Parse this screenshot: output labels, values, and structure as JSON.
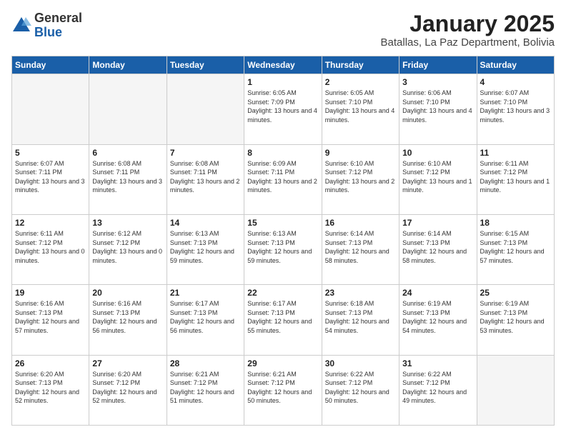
{
  "logo": {
    "general": "General",
    "blue": "Blue"
  },
  "header": {
    "title": "January 2025",
    "subtitle": "Batallas, La Paz Department, Bolivia"
  },
  "weekdays": [
    "Sunday",
    "Monday",
    "Tuesday",
    "Wednesday",
    "Thursday",
    "Friday",
    "Saturday"
  ],
  "weeks": [
    [
      {
        "day": "",
        "sunrise": "",
        "sunset": "",
        "daylight": "",
        "empty": true
      },
      {
        "day": "",
        "sunrise": "",
        "sunset": "",
        "daylight": "",
        "empty": true
      },
      {
        "day": "",
        "sunrise": "",
        "sunset": "",
        "daylight": "",
        "empty": true
      },
      {
        "day": "1",
        "sunrise": "Sunrise: 6:05 AM",
        "sunset": "Sunset: 7:09 PM",
        "daylight": "Daylight: 13 hours and 4 minutes."
      },
      {
        "day": "2",
        "sunrise": "Sunrise: 6:05 AM",
        "sunset": "Sunset: 7:10 PM",
        "daylight": "Daylight: 13 hours and 4 minutes."
      },
      {
        "day": "3",
        "sunrise": "Sunrise: 6:06 AM",
        "sunset": "Sunset: 7:10 PM",
        "daylight": "Daylight: 13 hours and 4 minutes."
      },
      {
        "day": "4",
        "sunrise": "Sunrise: 6:07 AM",
        "sunset": "Sunset: 7:10 PM",
        "daylight": "Daylight: 13 hours and 3 minutes."
      }
    ],
    [
      {
        "day": "5",
        "sunrise": "Sunrise: 6:07 AM",
        "sunset": "Sunset: 7:11 PM",
        "daylight": "Daylight: 13 hours and 3 minutes."
      },
      {
        "day": "6",
        "sunrise": "Sunrise: 6:08 AM",
        "sunset": "Sunset: 7:11 PM",
        "daylight": "Daylight: 13 hours and 3 minutes."
      },
      {
        "day": "7",
        "sunrise": "Sunrise: 6:08 AM",
        "sunset": "Sunset: 7:11 PM",
        "daylight": "Daylight: 13 hours and 2 minutes."
      },
      {
        "day": "8",
        "sunrise": "Sunrise: 6:09 AM",
        "sunset": "Sunset: 7:11 PM",
        "daylight": "Daylight: 13 hours and 2 minutes."
      },
      {
        "day": "9",
        "sunrise": "Sunrise: 6:10 AM",
        "sunset": "Sunset: 7:12 PM",
        "daylight": "Daylight: 13 hours and 2 minutes."
      },
      {
        "day": "10",
        "sunrise": "Sunrise: 6:10 AM",
        "sunset": "Sunset: 7:12 PM",
        "daylight": "Daylight: 13 hours and 1 minute."
      },
      {
        "day": "11",
        "sunrise": "Sunrise: 6:11 AM",
        "sunset": "Sunset: 7:12 PM",
        "daylight": "Daylight: 13 hours and 1 minute."
      }
    ],
    [
      {
        "day": "12",
        "sunrise": "Sunrise: 6:11 AM",
        "sunset": "Sunset: 7:12 PM",
        "daylight": "Daylight: 13 hours and 0 minutes."
      },
      {
        "day": "13",
        "sunrise": "Sunrise: 6:12 AM",
        "sunset": "Sunset: 7:12 PM",
        "daylight": "Daylight: 13 hours and 0 minutes."
      },
      {
        "day": "14",
        "sunrise": "Sunrise: 6:13 AM",
        "sunset": "Sunset: 7:13 PM",
        "daylight": "Daylight: 12 hours and 59 minutes."
      },
      {
        "day": "15",
        "sunrise": "Sunrise: 6:13 AM",
        "sunset": "Sunset: 7:13 PM",
        "daylight": "Daylight: 12 hours and 59 minutes."
      },
      {
        "day": "16",
        "sunrise": "Sunrise: 6:14 AM",
        "sunset": "Sunset: 7:13 PM",
        "daylight": "Daylight: 12 hours and 58 minutes."
      },
      {
        "day": "17",
        "sunrise": "Sunrise: 6:14 AM",
        "sunset": "Sunset: 7:13 PM",
        "daylight": "Daylight: 12 hours and 58 minutes."
      },
      {
        "day": "18",
        "sunrise": "Sunrise: 6:15 AM",
        "sunset": "Sunset: 7:13 PM",
        "daylight": "Daylight: 12 hours and 57 minutes."
      }
    ],
    [
      {
        "day": "19",
        "sunrise": "Sunrise: 6:16 AM",
        "sunset": "Sunset: 7:13 PM",
        "daylight": "Daylight: 12 hours and 57 minutes."
      },
      {
        "day": "20",
        "sunrise": "Sunrise: 6:16 AM",
        "sunset": "Sunset: 7:13 PM",
        "daylight": "Daylight: 12 hours and 56 minutes."
      },
      {
        "day": "21",
        "sunrise": "Sunrise: 6:17 AM",
        "sunset": "Sunset: 7:13 PM",
        "daylight": "Daylight: 12 hours and 56 minutes."
      },
      {
        "day": "22",
        "sunrise": "Sunrise: 6:17 AM",
        "sunset": "Sunset: 7:13 PM",
        "daylight": "Daylight: 12 hours and 55 minutes."
      },
      {
        "day": "23",
        "sunrise": "Sunrise: 6:18 AM",
        "sunset": "Sunset: 7:13 PM",
        "daylight": "Daylight: 12 hours and 54 minutes."
      },
      {
        "day": "24",
        "sunrise": "Sunrise: 6:19 AM",
        "sunset": "Sunset: 7:13 PM",
        "daylight": "Daylight: 12 hours and 54 minutes."
      },
      {
        "day": "25",
        "sunrise": "Sunrise: 6:19 AM",
        "sunset": "Sunset: 7:13 PM",
        "daylight": "Daylight: 12 hours and 53 minutes."
      }
    ],
    [
      {
        "day": "26",
        "sunrise": "Sunrise: 6:20 AM",
        "sunset": "Sunset: 7:13 PM",
        "daylight": "Daylight: 12 hours and 52 minutes."
      },
      {
        "day": "27",
        "sunrise": "Sunrise: 6:20 AM",
        "sunset": "Sunset: 7:12 PM",
        "daylight": "Daylight: 12 hours and 52 minutes."
      },
      {
        "day": "28",
        "sunrise": "Sunrise: 6:21 AM",
        "sunset": "Sunset: 7:12 PM",
        "daylight": "Daylight: 12 hours and 51 minutes."
      },
      {
        "day": "29",
        "sunrise": "Sunrise: 6:21 AM",
        "sunset": "Sunset: 7:12 PM",
        "daylight": "Daylight: 12 hours and 50 minutes."
      },
      {
        "day": "30",
        "sunrise": "Sunrise: 6:22 AM",
        "sunset": "Sunset: 7:12 PM",
        "daylight": "Daylight: 12 hours and 50 minutes."
      },
      {
        "day": "31",
        "sunrise": "Sunrise: 6:22 AM",
        "sunset": "Sunset: 7:12 PM",
        "daylight": "Daylight: 12 hours and 49 minutes."
      },
      {
        "day": "",
        "sunrise": "",
        "sunset": "",
        "daylight": "",
        "empty": true
      }
    ]
  ]
}
